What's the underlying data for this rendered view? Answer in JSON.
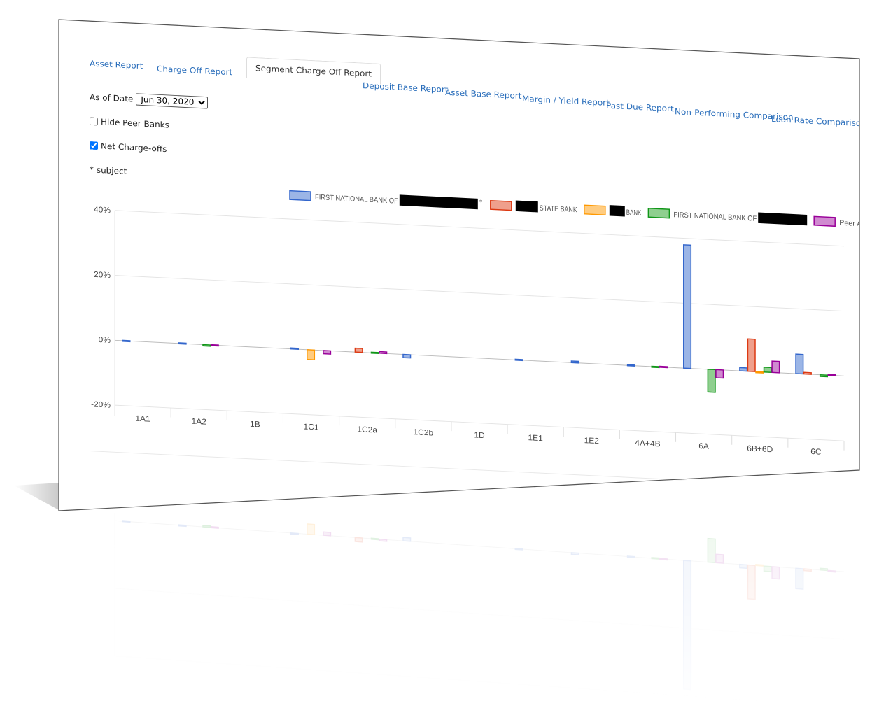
{
  "tabs": [
    {
      "label": "Asset Report",
      "active": false
    },
    {
      "label": "Charge Off Report",
      "active": false
    },
    {
      "label": "Segment Charge Off Report",
      "active": true
    },
    {
      "label": "Deposit Base Report",
      "active": false
    },
    {
      "label": "Asset Base Report",
      "active": false
    },
    {
      "label": "Margin / Yield Report",
      "active": false
    },
    {
      "label": "Past Due Report",
      "active": false
    },
    {
      "label": "Non-Performing Comparison",
      "active": false
    },
    {
      "label": "Loan Rate Comparison",
      "active": false
    }
  ],
  "controls": {
    "as_of_date_label": "As of Date",
    "as_of_date_value": "Jun 30, 2020",
    "hide_peer_banks_label": "Hide Peer Banks",
    "hide_peer_banks_checked": false,
    "net_chargeoffs_label": "Net Charge-offs",
    "net_chargeoffs_checked": true,
    "subject_note": "* subject"
  },
  "chart_data": {
    "type": "bar",
    "title": "",
    "xlabel": "",
    "ylabel": "",
    "ylim": [
      -20,
      40
    ],
    "yticks": [
      "40%",
      "20%",
      "0%",
      "-20%"
    ],
    "ytick_values": [
      40,
      20,
      0,
      -20
    ],
    "grid": true,
    "legend_position": "top-right",
    "categories": [
      "1A1",
      "1A2",
      "1B",
      "1C1",
      "1C2a",
      "1C2b",
      "1D",
      "1E1",
      "1E2",
      "4A+4B",
      "6A",
      "6B+6D",
      "6C"
    ],
    "series": [
      {
        "name": "FIRST NATIONAL BANK OF [redacted]*",
        "redacted": true,
        "suffix": "*",
        "fill": "#9bb5e6",
        "stroke": "#3366cc",
        "values": [
          0.1,
          0.2,
          0,
          0.3,
          0,
          -1,
          0,
          0.2,
          0.5,
          0.2,
          38,
          1,
          6
        ]
      },
      {
        "name": "[redacted] STATE BANK",
        "redacted": true,
        "fill": "#ef9f8c",
        "stroke": "#dc3912",
        "values": [
          0,
          0,
          0,
          0,
          1.2,
          0,
          0,
          0,
          0,
          0,
          0,
          10,
          0.5
        ]
      },
      {
        "name": "[redacted] BANK",
        "redacted": true,
        "fill": "#ffcc80",
        "stroke": "#ff9900",
        "values": [
          0,
          0,
          0,
          -3,
          0,
          0,
          0,
          0,
          0,
          0,
          0,
          -0.3,
          0
        ]
      },
      {
        "name": "FIRST NATIONAL BANK OF [redacted]",
        "redacted": true,
        "fill": "#8fcf8f",
        "stroke": "#109618",
        "values": [
          0,
          -0.4,
          0,
          0,
          0.2,
          0,
          0,
          0,
          0,
          0.1,
          -7,
          1.5,
          -0.5
        ]
      },
      {
        "name": "Peer Average",
        "redacted": false,
        "fill": "#d08ad0",
        "stroke": "#990099",
        "values": [
          0,
          0.1,
          0,
          -1,
          0.5,
          0,
          0,
          0,
          0,
          0.2,
          -2.5,
          3.5,
          0.3
        ]
      }
    ],
    "legend": [
      {
        "text": "FIRST NATIONAL BANK OF",
        "suffix": "*"
      },
      {
        "prefix_redacted": true,
        "text": "STATE BANK"
      },
      {
        "prefix_redacted": true,
        "text": "BANK"
      },
      {
        "text": "FIRST NATIONAL BANK OF",
        "suffix": ""
      },
      {
        "text": "Peer Average"
      }
    ]
  }
}
